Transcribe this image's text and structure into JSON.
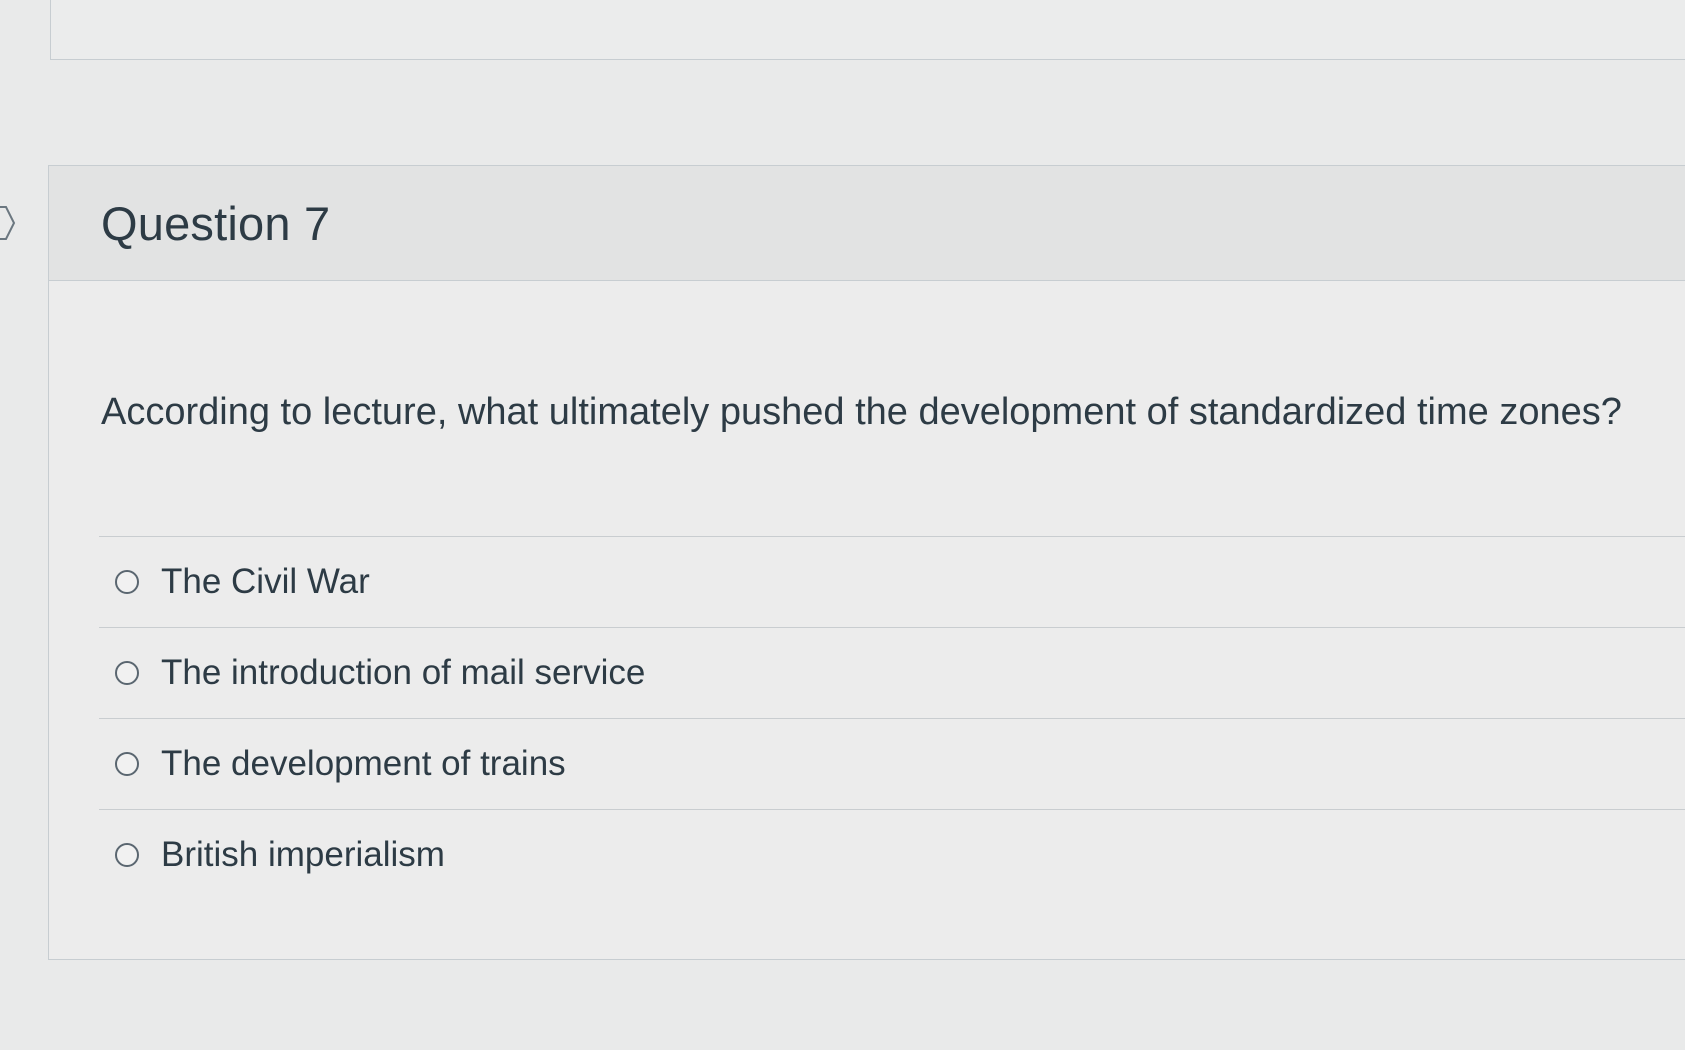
{
  "question": {
    "title": "Question 7",
    "text": "According to lecture, what ultimately pushed the development of standardized time zones?",
    "answers": [
      {
        "label": "The Civil War",
        "selected": false
      },
      {
        "label": "The introduction of mail service",
        "selected": false
      },
      {
        "label": "The development of trains",
        "selected": false
      },
      {
        "label": "British imperialism",
        "selected": false
      }
    ]
  },
  "icons": {
    "flag": "flag-question-icon"
  }
}
